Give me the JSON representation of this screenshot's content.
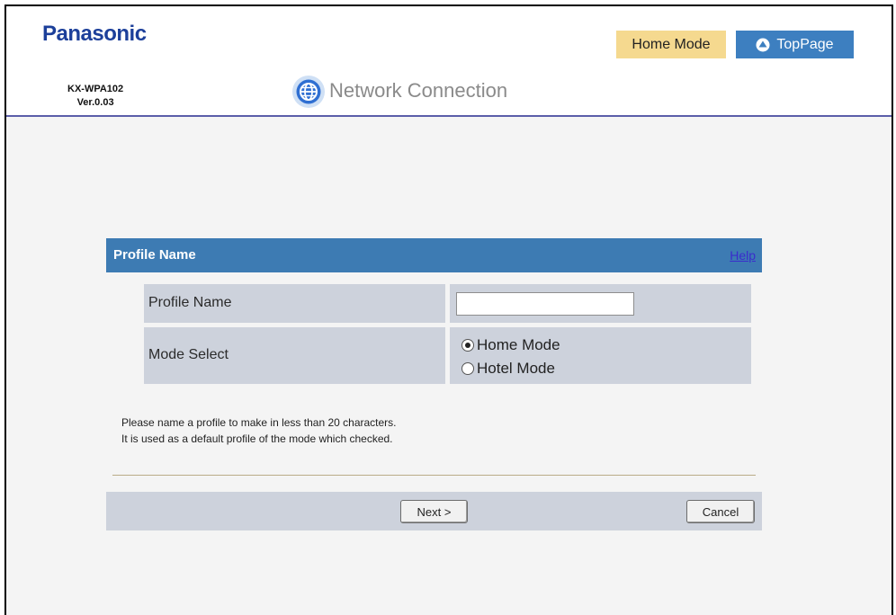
{
  "header": {
    "brand": "Panasonic",
    "model": "KX-WPA102",
    "version": "Ver.0.03",
    "page_title": "Network Connection",
    "mode_indicator": "Home Mode",
    "top_page_label": "TopPage"
  },
  "panel": {
    "title": "Profile Name",
    "help_label": "Help",
    "rows": {
      "profile_name": {
        "label": "Profile Name",
        "value": ""
      },
      "mode_select": {
        "label": "Mode Select",
        "options": [
          {
            "label": "Home Mode",
            "checked": true
          },
          {
            "label": "Hotel Mode",
            "checked": false
          }
        ]
      }
    },
    "notes": [
      "Please name a profile to make in less than 20 characters.",
      "It is used as a default profile of the mode which checked."
    ]
  },
  "actions": {
    "next_label": "Next >",
    "cancel_label": "Cancel"
  },
  "colors": {
    "brand_blue": "#1c3f9a",
    "panel_header": "#3d7bb3",
    "row_bg": "#cdd2dc",
    "mode_badge": "#f5d98f",
    "top_page_button": "#3d7fc0"
  },
  "icons": {
    "globe": "globe-icon",
    "top_page": "up-arrow-circle-icon"
  }
}
